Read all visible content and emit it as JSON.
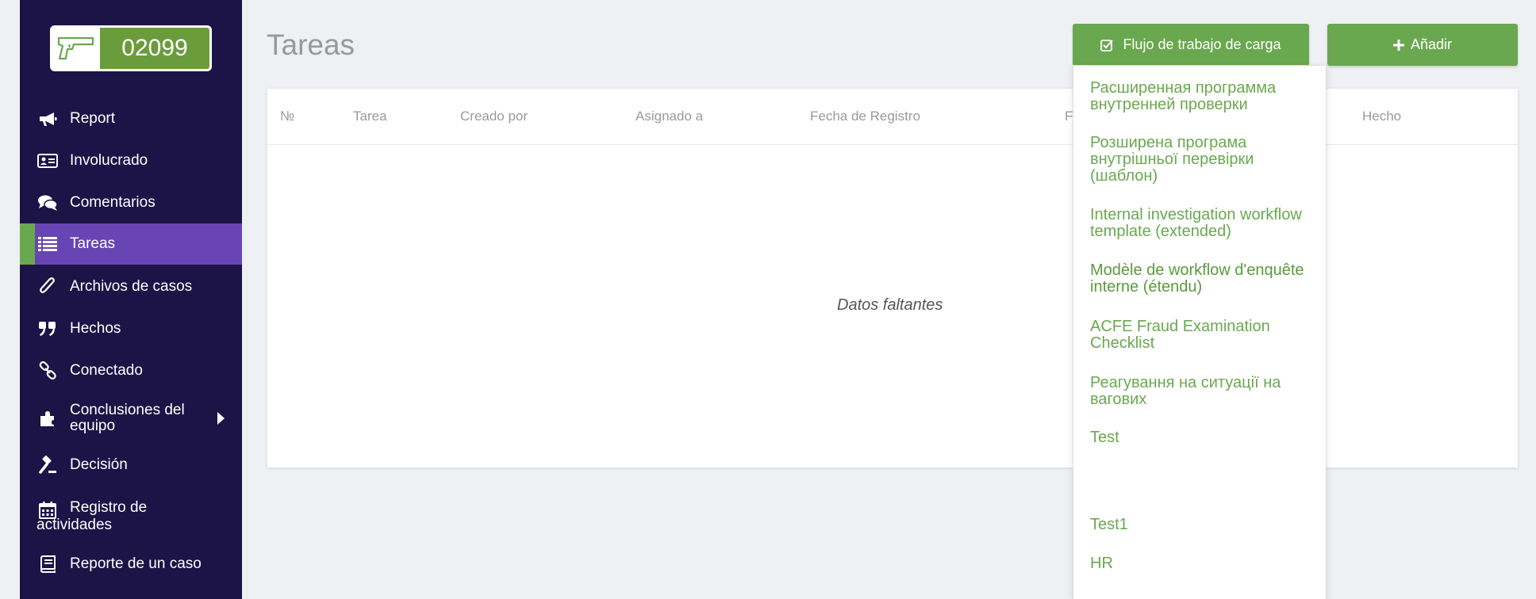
{
  "case": {
    "number": "02099",
    "icon": "gun-icon"
  },
  "sidebar": {
    "items": [
      {
        "label": "Report",
        "icon": "megaphone-icon"
      },
      {
        "label": "Involucrado",
        "icon": "id-card-icon"
      },
      {
        "label": "Comentarios",
        "icon": "comments-icon"
      },
      {
        "label": "Tareas",
        "icon": "list-icon",
        "active": true
      },
      {
        "label": "Archivos de casos",
        "icon": "paperclip-icon"
      },
      {
        "label": "Hechos",
        "icon": "quote-icon"
      },
      {
        "label": "Conectado",
        "icon": "link-icon"
      },
      {
        "label": "Conclusiones del equipo",
        "icon": "puzzle-icon"
      },
      {
        "label": "Decisión",
        "icon": "gavel-icon"
      },
      {
        "label": "Registro de actividades",
        "icon": "calendar-icon"
      },
      {
        "label": "Reporte de un caso",
        "icon": "book-icon"
      }
    ]
  },
  "main": {
    "title": "Tareas",
    "buttons": {
      "load_workflow": "Flujo de trabajo de carga",
      "add": "Añadir"
    },
    "table": {
      "columns": [
        "№",
        "Tarea",
        "Creado por",
        "Asignado a",
        "Fecha de Registro",
        "F",
        "Hecho"
      ],
      "empty_text": "Datos faltantes"
    }
  },
  "dropdown": {
    "items": [
      "Расширенная программа внутренней проверки",
      "Розширена програма внутрішньої перевірки (шаблон)",
      "Internal investigation workflow template (extended)",
      "Modèle de workflow d'enquête interne (étendu)",
      "ACFE Fraud Examination Checklist",
      "Реагування на ситуації на вагових",
      "Test",
      "",
      "Test1",
      "HR"
    ]
  },
  "colors": {
    "sidebar_bg": "#1c1446",
    "active_item": "#6944b4",
    "accent_green": "#6aa84f"
  }
}
